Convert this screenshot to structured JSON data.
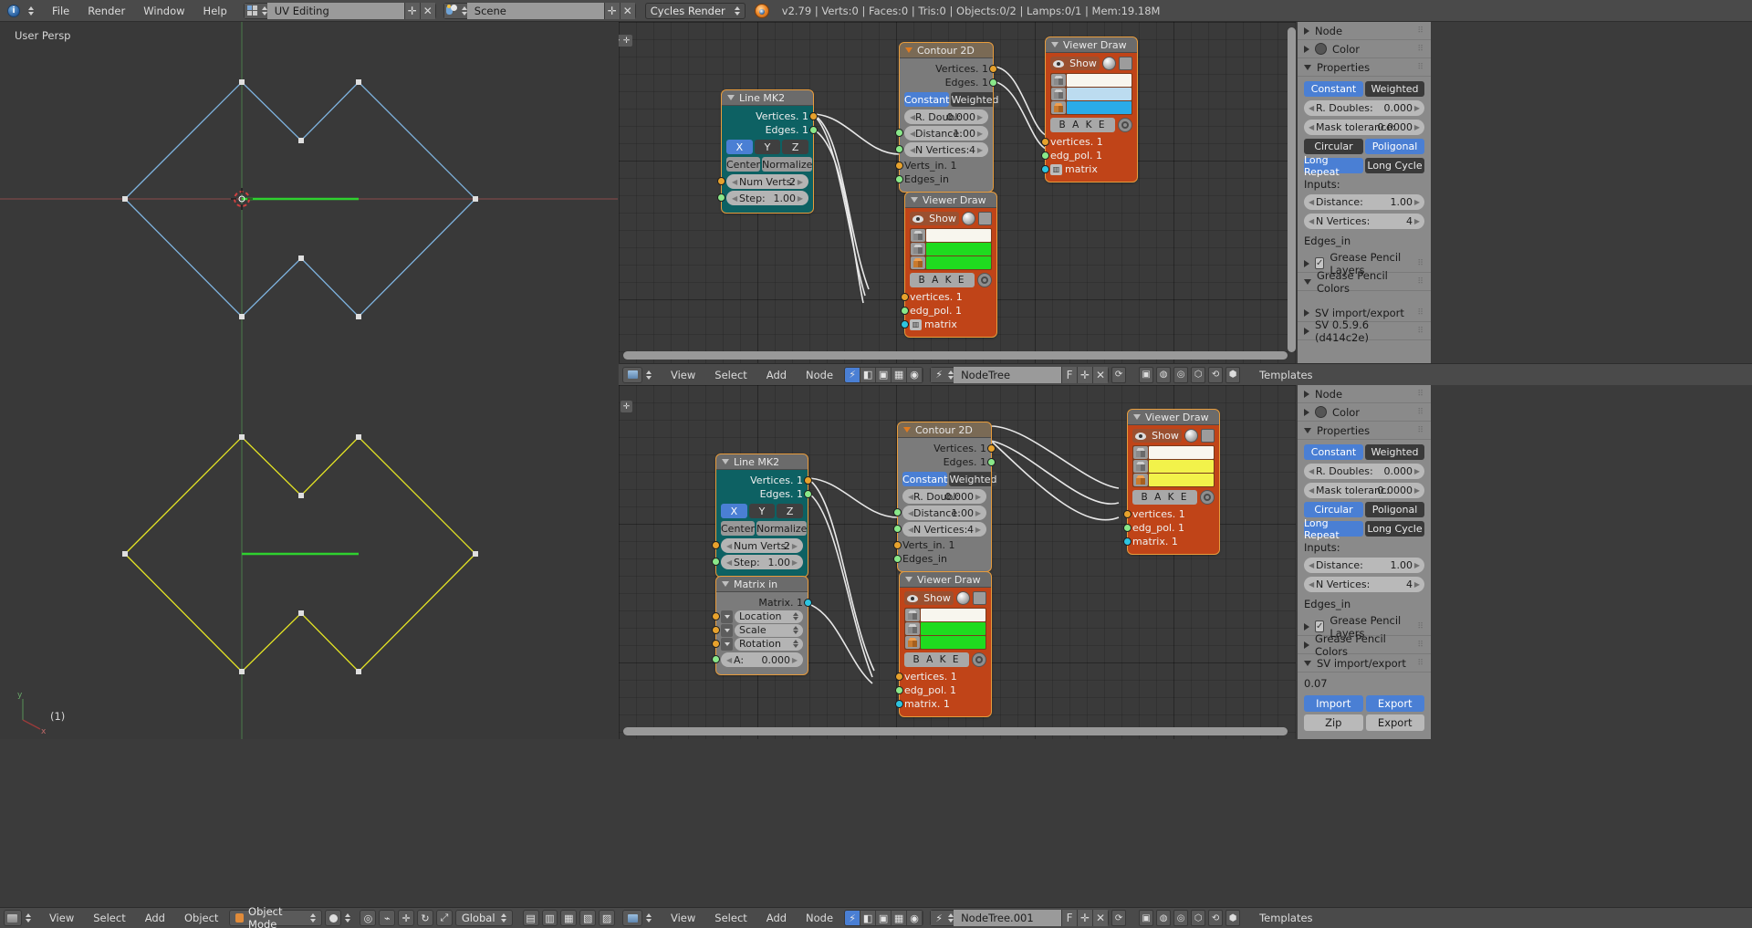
{
  "topbar": {
    "menus": [
      "File",
      "Render",
      "Window",
      "Help"
    ],
    "screen_layout": "UV Editing",
    "scene": "Scene",
    "render_engine": "Cycles Render",
    "status": "v2.79 | Verts:0 | Faces:0 | Tris:0 | Objects:0/2 | Lamps:0/1 | Mem:19.18M"
  },
  "viewport": {
    "view_label": "User Persp",
    "object_count": "(1)"
  },
  "node_editor_top": {
    "nodes": [
      {
        "title": "Line MK2",
        "outputs": [
          "Vertices. 1",
          "Edges. 1"
        ],
        "axis_buttons": [
          "X",
          "Y",
          "Z"
        ],
        "mode_buttons": [
          "Center",
          "Normalize"
        ],
        "fields": [
          {
            "label": "Num Verts:",
            "value": "2"
          },
          {
            "label": "Step:",
            "value": "1.00"
          }
        ]
      },
      {
        "title": "Contour 2D",
        "outputs": [
          "Vertices. 1",
          "Edges. 1"
        ],
        "toggle": [
          "Constant",
          "Weighted"
        ],
        "fields": [
          {
            "label": "R. Doubl:",
            "value": "0.000"
          },
          {
            "label": "Distance:",
            "value": "1.00"
          },
          {
            "label": "N Vertices:",
            "value": "4"
          }
        ],
        "inputs": [
          "Verts_in. 1",
          "Edges_in"
        ]
      },
      {
        "title": "Viewer Draw",
        "show_label": "Show",
        "bake_label": "B A K E",
        "swatches": [
          "#f8f6ee",
          "#bcdcf0",
          "#2aabe8"
        ],
        "inputs": [
          "vertices. 1",
          "edg_pol. 1",
          "matrix"
        ]
      },
      {
        "title": "Viewer Draw",
        "show_label": "Show",
        "bake_label": "B A K E",
        "swatches": [
          "#f8f6ee",
          "#1fdb1f",
          "#1fdb1f"
        ],
        "inputs": [
          "vertices. 1",
          "edg_pol. 1",
          "matrix"
        ]
      }
    ]
  },
  "node_header_top": {
    "menus": [
      "View",
      "Select",
      "Add",
      "Node"
    ],
    "tree_name": "NodeTree",
    "f_label": "F",
    "templates_label": "Templates"
  },
  "node_editor_bottom": {
    "nodes": [
      {
        "title": "Line MK2",
        "outputs": [
          "Vertices. 1",
          "Edges. 1"
        ],
        "axis_buttons": [
          "X",
          "Y",
          "Z"
        ],
        "mode_buttons": [
          "Center",
          "Normalize"
        ],
        "fields": [
          {
            "label": "Num Verts:",
            "value": "2"
          },
          {
            "label": "Step:",
            "value": "1.00"
          }
        ]
      },
      {
        "title": "Matrix in",
        "outputs": [
          "Matrix. 1"
        ],
        "rows": [
          "Location",
          "Scale",
          "Rotation"
        ],
        "fields": [
          {
            "label": "A:",
            "value": "0.000"
          }
        ]
      },
      {
        "title": "Contour 2D",
        "outputs": [
          "Vertices. 1",
          "Edges. 1"
        ],
        "toggle": [
          "Constant",
          "Weighted"
        ],
        "fields": [
          {
            "label": "R. Doubl:",
            "value": "0.000"
          },
          {
            "label": "Distance:",
            "value": "1.00"
          },
          {
            "label": "N Vertices:",
            "value": "4"
          }
        ],
        "inputs": [
          "Verts_in. 1",
          "Edges_in"
        ]
      },
      {
        "title": "Viewer Draw",
        "show_label": "Show",
        "bake_label": "B A K E",
        "swatches": [
          "#f8f6ee",
          "#f2f24a",
          "#f2f24a"
        ],
        "inputs": [
          "vertices. 1",
          "edg_pol. 1",
          "matrix. 1"
        ]
      },
      {
        "title": "Viewer Draw",
        "show_label": "Show",
        "bake_label": "B A K E",
        "swatches": [
          "#f8f6ee",
          "#1fdb1f",
          "#1fdb1f"
        ],
        "inputs": [
          "vertices. 1",
          "edg_pol. 1",
          "matrix. 1"
        ]
      }
    ]
  },
  "node_header_bottom": {
    "menus": [
      "View",
      "Select",
      "Add",
      "Node"
    ],
    "tree_name": "NodeTree.001",
    "f_label": "F",
    "templates_label": "Templates"
  },
  "props_top": {
    "node_label": "Node",
    "color_label": "Color",
    "properties_label": "Properties",
    "toggle1": [
      "Constant",
      "Weighted"
    ],
    "r_doubles": {
      "label": "R. Doubles:",
      "value": "0.000"
    },
    "mask_tolerance": {
      "label": "Mask tolerance:",
      "value": "0.0000"
    },
    "toggle2": [
      "Circular",
      "Poligonal"
    ],
    "toggle3": [
      "Long Repeat",
      "Long Cycle"
    ],
    "inputs_label": "Inputs:",
    "distance": {
      "label": "Distance:",
      "value": "1.00"
    },
    "n_vertices": {
      "label": "N Vertices:",
      "value": "4"
    },
    "edges_in": "Edges_in",
    "gp_layers": "Grease Pencil Layers",
    "gp_colors": "Grease Pencil Colors",
    "sv_import_export": "SV import/export",
    "sv_version": "SV 0.5.9.6 (d414c2e)"
  },
  "props_bottom": {
    "node_label": "Node",
    "color_label": "Color",
    "properties_label": "Properties",
    "toggle1": [
      "Constant",
      "Weighted"
    ],
    "r_doubles": {
      "label": "R. Doubles:",
      "value": "0.000"
    },
    "mask_tolerance": {
      "label": "Mask toleranc:",
      "value": "0.0000"
    },
    "toggle2": [
      "Circular",
      "Poligonal"
    ],
    "toggle3": [
      "Long Repeat",
      "Long Cycle"
    ],
    "inputs_label": "Inputs:",
    "distance": {
      "label": "Distance:",
      "value": "1.00"
    },
    "n_vertices": {
      "label": "N Vertices:",
      "value": "4"
    },
    "edges_in": "Edges_in",
    "gp_layers": "Grease Pencil Layers",
    "gp_colors": "Grease Pencil Colors",
    "sv_import_export": "SV import/export",
    "sv_value": "0.07",
    "import_label": "Import",
    "export_label": "Export",
    "zip_label": "Zip",
    "export2_label": "Export"
  },
  "botbar_left": {
    "menus": [
      "View",
      "Select",
      "Add",
      "Object"
    ],
    "mode": "Object Mode",
    "orientation": "Global"
  },
  "botbar_right": {
    "menus": [
      "View",
      "Select",
      "Add",
      "Node"
    ],
    "tree_name": "NodeTree.001",
    "f_label": "F",
    "templates_label": "Templates"
  }
}
